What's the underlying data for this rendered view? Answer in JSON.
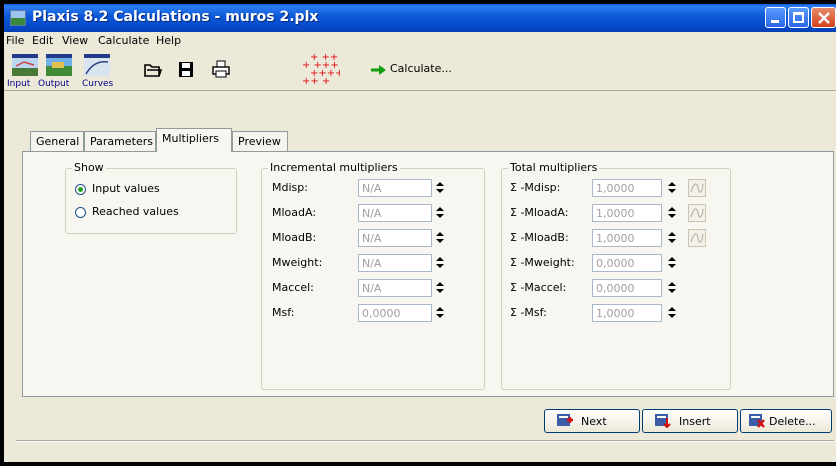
{
  "window": {
    "title": "Plaxis 8.2 Calculations - muros 2.plx"
  },
  "menu": [
    "File",
    "Edit",
    "View",
    "Calculate",
    "Help"
  ],
  "toolbar": {
    "input": "Input",
    "output": "Output",
    "curves": "Curves",
    "calculate": "Calculate..."
  },
  "tabs": [
    "General",
    "Parameters",
    "Multipliers",
    "Preview"
  ],
  "show": {
    "title": "Show",
    "input_values": "Input values",
    "reached_values": "Reached values",
    "selected": "Input values"
  },
  "incremental": {
    "title": "Incremental multipliers",
    "rows": [
      {
        "label": "Mdisp:",
        "value": "N/A"
      },
      {
        "label": "MloadA:",
        "value": "N/A"
      },
      {
        "label": "MloadB:",
        "value": "N/A"
      },
      {
        "label": "Mweight:",
        "value": "N/A"
      },
      {
        "label": "Maccel:",
        "value": "N/A"
      },
      {
        "label": "Msf:",
        "value": "0,0000"
      }
    ]
  },
  "total": {
    "title": "Total multipliers",
    "rows": [
      {
        "label": "Σ -Mdisp:",
        "value": "1,0000"
      },
      {
        "label": "Σ -MloadA:",
        "value": "1,0000"
      },
      {
        "label": "Σ -MloadB:",
        "value": "1,0000"
      },
      {
        "label": "Σ -Mweight:",
        "value": "0,0000"
      },
      {
        "label": "Σ -Maccel:",
        "value": "0,0000"
      },
      {
        "label": "Σ -Msf:",
        "value": "1,0000"
      }
    ]
  },
  "buttons": {
    "next": "Next",
    "insert": "Insert",
    "delete": "Delete..."
  }
}
